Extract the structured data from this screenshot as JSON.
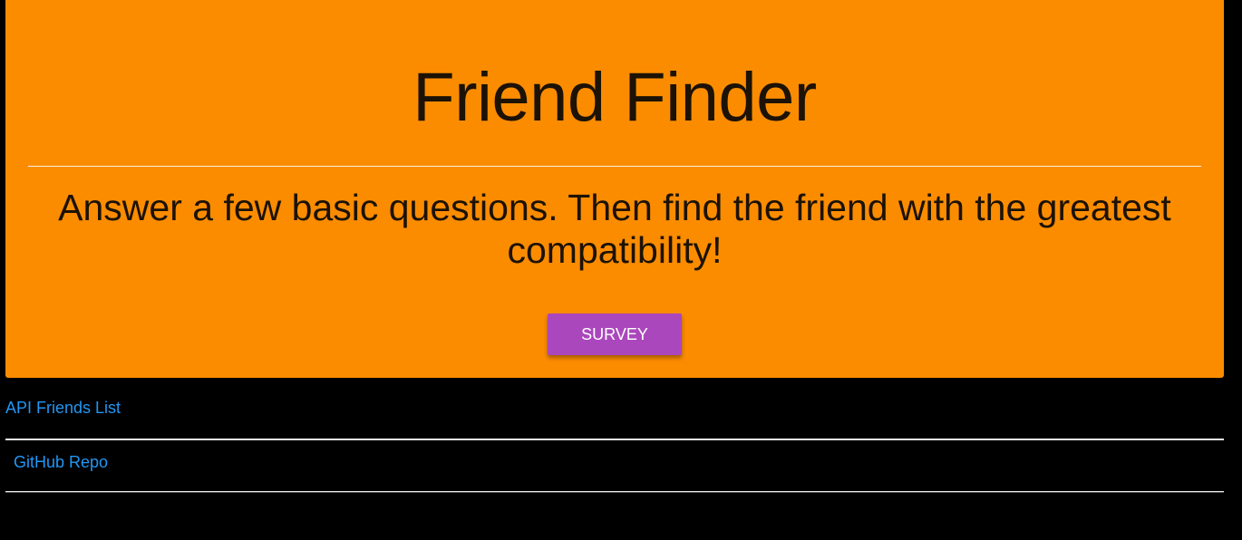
{
  "header": {
    "title": "Friend Finder",
    "lead": "Answer a few basic questions. Then find the friend with the greatest compatibility!",
    "survey_label": "SURVEY"
  },
  "footer": {
    "links": [
      {
        "label": "API Friends List"
      },
      {
        "label": "GitHub Repo"
      }
    ]
  },
  "colors": {
    "jumbotron_bg": "#fb8c00",
    "button_bg": "#ab47bc",
    "link": "#2196f3",
    "page_bg": "#000000"
  }
}
